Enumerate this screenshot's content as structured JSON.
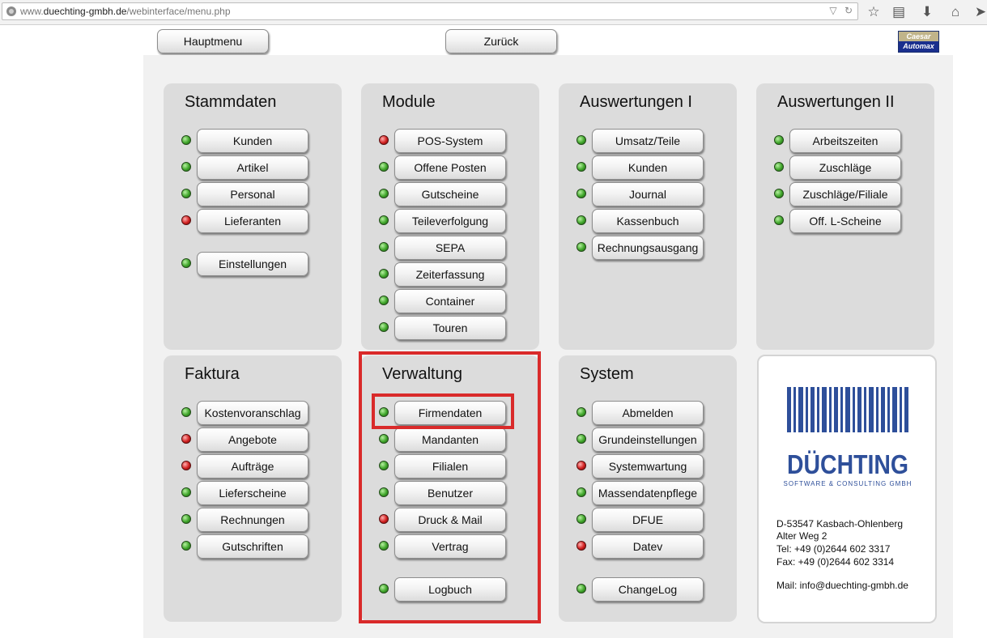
{
  "browser": {
    "url_prefix": "www.",
    "url_domain": "duechting-gmbh.de",
    "url_path": "/webinterface/menu.php",
    "icons": [
      "globe-icon",
      "dropdown-icon",
      "reload-icon",
      "bookmark-star-icon",
      "reading-list-icon",
      "download-icon",
      "home-icon",
      "send-icon"
    ]
  },
  "header": {
    "hauptmenu_label": "Hauptmenu",
    "zurueck_label": "Zurück",
    "logo_top": "Caesar",
    "logo_bottom": "Automax"
  },
  "status_colors": {
    "green": "#3fa52a",
    "red": "#d11f1f"
  },
  "panels": {
    "stammdaten": {
      "title": "Stammdaten",
      "items": [
        {
          "label": "Kunden",
          "status": "green"
        },
        {
          "label": "Artikel",
          "status": "green"
        },
        {
          "label": "Personal",
          "status": "green"
        },
        {
          "label": "Lieferanten",
          "status": "red"
        },
        {
          "label": "Einstellungen",
          "status": "green"
        }
      ]
    },
    "module": {
      "title": "Module",
      "items": [
        {
          "label": "POS-System",
          "status": "red"
        },
        {
          "label": "Offene Posten",
          "status": "green"
        },
        {
          "label": "Gutscheine",
          "status": "green"
        },
        {
          "label": "Teileverfolgung",
          "status": "green"
        },
        {
          "label": "SEPA",
          "status": "green"
        },
        {
          "label": "Zeiterfassung",
          "status": "green"
        },
        {
          "label": "Container",
          "status": "green"
        },
        {
          "label": "Touren",
          "status": "green"
        }
      ]
    },
    "auswertungen1": {
      "title": "Auswertungen I",
      "items": [
        {
          "label": "Umsatz/Teile",
          "status": "green"
        },
        {
          "label": "Kunden",
          "status": "green"
        },
        {
          "label": "Journal",
          "status": "green"
        },
        {
          "label": "Kassenbuch",
          "status": "green"
        },
        {
          "label": "Rechnungsausgang",
          "status": "green"
        }
      ]
    },
    "auswertungen2": {
      "title": "Auswertungen II",
      "items": [
        {
          "label": "Arbeitszeiten",
          "status": "green"
        },
        {
          "label": "Zuschläge",
          "status": "green"
        },
        {
          "label": "Zuschläge/Filiale",
          "status": "green"
        },
        {
          "label": "Off. L-Scheine",
          "status": "green"
        }
      ]
    },
    "faktura": {
      "title": "Faktura",
      "items": [
        {
          "label": "Kostenvoranschlag",
          "status": "green"
        },
        {
          "label": "Angebote",
          "status": "red"
        },
        {
          "label": "Aufträge",
          "status": "red"
        },
        {
          "label": "Lieferscheine",
          "status": "green"
        },
        {
          "label": "Rechnungen",
          "status": "green"
        },
        {
          "label": "Gutschriften",
          "status": "green"
        }
      ]
    },
    "verwaltung": {
      "title": "Verwaltung",
      "items": [
        {
          "label": "Firmendaten",
          "status": "green"
        },
        {
          "label": "Mandanten",
          "status": "green"
        },
        {
          "label": "Filialen",
          "status": "green"
        },
        {
          "label": "Benutzer",
          "status": "green"
        },
        {
          "label": "Druck & Mail",
          "status": "red"
        },
        {
          "label": "Vertrag",
          "status": "green"
        },
        {
          "label": "Logbuch",
          "status": "green"
        }
      ]
    },
    "system": {
      "title": "System",
      "items": [
        {
          "label": "Abmelden",
          "status": "green"
        },
        {
          "label": "Grundeinstellungen",
          "status": "green"
        },
        {
          "label": "Systemwartung",
          "status": "red"
        },
        {
          "label": "Massendatenpflege",
          "status": "green"
        },
        {
          "label": "DFUE",
          "status": "green"
        },
        {
          "label": "Datev",
          "status": "red"
        },
        {
          "label": "ChangeLog",
          "status": "green"
        }
      ]
    }
  },
  "company": {
    "logo_text": "DÜCHTING",
    "logo_subtitle": "SOFTWARE & CONSULTING GMBH",
    "address_line1": "D-53547 Kasbach-Ohlenberg",
    "address_line2": "Alter Weg 2",
    "tel": "Tel: +49 (0)2644 602 3317",
    "fax": "Fax: +49 (0)2644 602 3314",
    "mail": "Mail: info@duechting-gmbh.de"
  }
}
